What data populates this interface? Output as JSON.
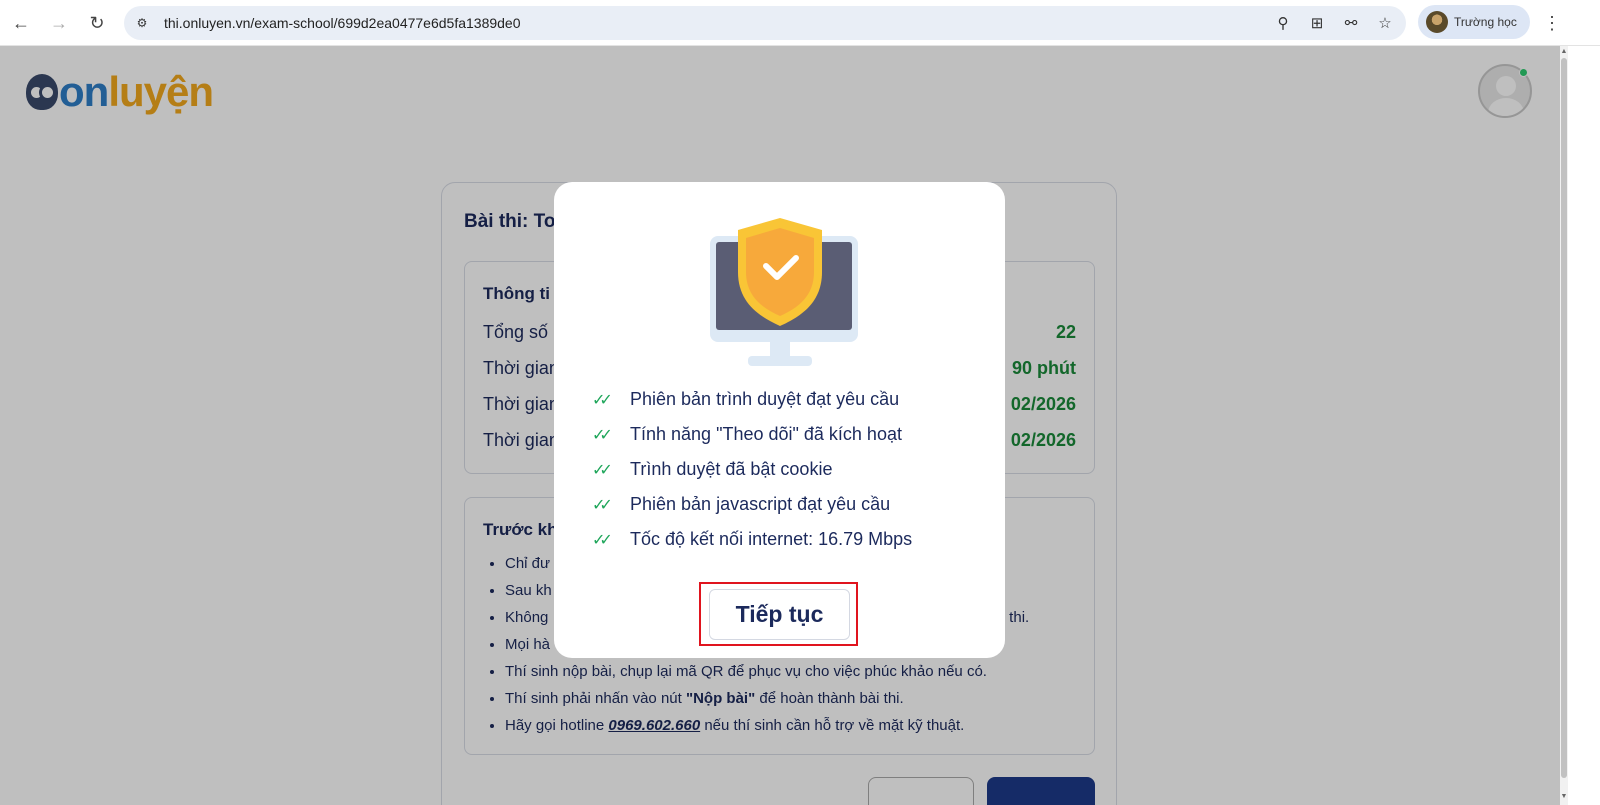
{
  "browser": {
    "url": "thi.onluyen.vn/exam-school/699d2ea0477e6d5fa1389de0",
    "profile_name": "Trường học",
    "icons": [
      "back-icon",
      "forward-icon",
      "reload-icon",
      "site-settings-icon",
      "zoom-icon",
      "install-icon",
      "password-key-icon",
      "bookmark-star-icon",
      "menu-dots-icon"
    ]
  },
  "page": {
    "logo_on": "on",
    "logo_luyen": "luyện",
    "card_title": "Bài thi: To",
    "info": {
      "heading": "Thông ti",
      "rows": [
        {
          "label": "Tổng số",
          "value": "22"
        },
        {
          "label": "Thời gian",
          "value": "90 phút"
        },
        {
          "label": "Thời gian",
          "value": "02/2026"
        },
        {
          "label": "Thời gian",
          "value": "02/2026"
        }
      ]
    },
    "rules": {
      "heading": "Trước kh",
      "items": [
        "Chỉ đư",
        "Sau kh",
        "Không",
        "Mọi hà",
        "Thí sinh nộp bài, chụp lại mã QR để phục vụ cho việc phúc khảo nếu có.",
        "Thí sinh phải nhấn vào nút",
        "Hãy gọi hotline"
      ],
      "item3_tail": "bài thi.",
      "submit_bold": "\"Nộp bài\"",
      "submit_tail": "để hoàn thành bài thi.",
      "hotline": "0969.602.660",
      "hotline_tail": "nếu thí sinh cần hỗ trợ về mặt kỹ thuật."
    }
  },
  "modal": {
    "checks": [
      "Phiên bản trình duyệt đạt yêu cầu",
      "Tính năng \"Theo dõi\" đã kích hoạt",
      "Trình duyệt đã bật cookie",
      "Phiên bản javascript đạt yêu cầu",
      "Tốc độ kết nối internet: 16.79 Mbps"
    ],
    "continue_label": "Tiếp tục"
  },
  "colors": {
    "check_green": "#1ea65a",
    "value_green": "#1a8a3a",
    "highlight_red": "#e0141e",
    "text_navy": "#1c2a5c",
    "logo_blue": "#2e7ec7",
    "logo_yellow": "#f2a81e"
  }
}
